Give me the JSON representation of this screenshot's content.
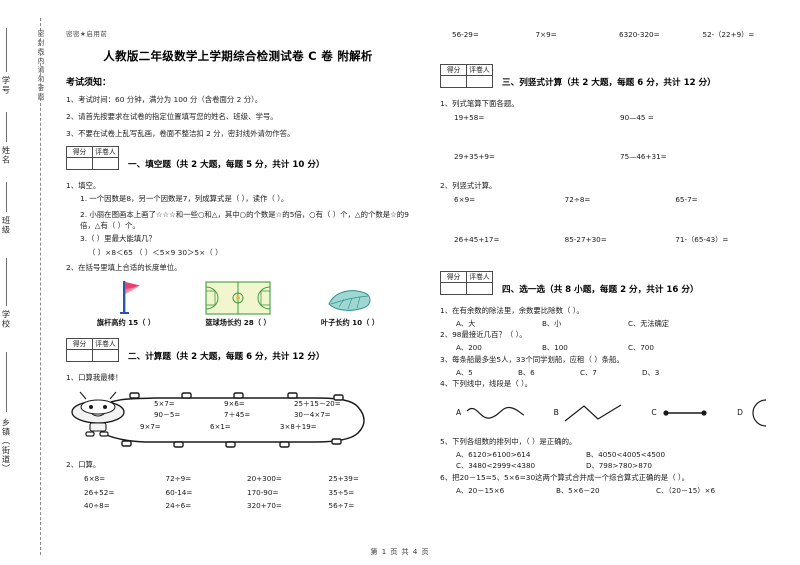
{
  "sidebar": {
    "fields": [
      "学号",
      "姓名",
      "班级",
      "学校",
      "乡镇（街道）"
    ],
    "seal_note": "密封线内请勿答题"
  },
  "header": {
    "secret_mark": "密密★启用前",
    "title": "人教版二年级数学上学期综合检测试卷 C 卷  附解析",
    "notice_title": "考试须知：",
    "notices": [
      "1、考试时间：60 分钟，满分为 100 分（含卷面分 2 分）。",
      "2、请首先按要求在试卷的指定位置填写您的姓名、班级、学号。",
      "3、不要在试卷上乱写乱画，卷面不整洁扣 2 分，密封线外请勿作答。"
    ]
  },
  "score_box": {
    "score_label": "得分",
    "grader_label": "评卷人"
  },
  "sections": {
    "one": {
      "title": "一、填空题（共 2 大题，每题 5 分，共计 10 分）",
      "q1_title": "1、填空。",
      "q1_items": [
        "1. 一个因数是8，另一个因数是7，列成算式是（                ），读作（                ）。",
        "2. 小丽在图画本上画了☆☆☆和一些○和△，其中○的个数是☆的5倍，○有（        ）个，△的个数是☆的9倍，△有（        ）个。",
        "3.（        ）里最大能填几？"
      ],
      "q1_fill": "（        ）×8＜65          （        ）＜5×9     30＞5×（        ）",
      "q2_title": "2、在括号里填上合适的长度单位。",
      "pictures": [
        {
          "icon": "flag-icon",
          "caption": "旗杆高约 15（        ）"
        },
        {
          "icon": "basketball-court-icon",
          "caption": "篮球场长约 28（        ）"
        },
        {
          "icon": "leaf-icon",
          "caption": "叶子长约 10（        ）"
        }
      ]
    },
    "two": {
      "title": "二、计算题（共 2 大题，每题 6 分，共计 12 分）",
      "q1_title": "1、口算我最棒！",
      "worm_items": [
        "5×7=",
        "9×6=",
        "25＋15－20=",
        "90－5=",
        "7＋45=",
        "30－4×7=",
        "9×7=",
        "6×1=",
        "3×8＋19="
      ],
      "q2_title": "2、口算。",
      "oral_items": [
        "6×8=",
        "72÷9=",
        "20+300=",
        "25+39=",
        "26+52=",
        "60-14=",
        "170-90=",
        "35÷5=",
        "40÷8=",
        "24÷6=",
        "320+70=",
        "56÷7=",
        "56-29=",
        "7×9=",
        "6320-320=",
        "52-（22+9）="
      ]
    },
    "three": {
      "title": "三、列竖式计算（共 2 大题，每题 6 分，共计 12 分）",
      "q1_title": "1、列式笔算下面各题。",
      "q1_items": [
        "19+58=",
        "90—45 =",
        "29+35+9=",
        "75—46+31="
      ],
      "q2_title": "2、列竖式计算。",
      "q2_items": [
        "6×9=",
        "72÷8=",
        "65-7=",
        "26+45+17=",
        "85-27+30=",
        "71-（65-43）="
      ]
    },
    "four": {
      "title": "四、选一选（共 8 小题，每题 2 分，共计 16 分）",
      "questions": [
        {
          "stem": "1、在有余数的除法里，余数要比除数（        ）。",
          "options": [
            "A、大",
            "B、小",
            "C、无法确定"
          ],
          "layout": "three"
        },
        {
          "stem": "2、98最接近几百？（        ）。",
          "options": [
            "A、200",
            "B、100",
            "C、700"
          ],
          "layout": "three"
        },
        {
          "stem": "3、每条船最多坐5人，33个同学划船，应租（        ）条船。",
          "options": [
            "A、5",
            "B、6",
            "C、7",
            "D、3"
          ],
          "layout": "four"
        },
        {
          "stem": "4、下列线中，线段是（        ）。",
          "options": [],
          "layout": "lines",
          "line_labels": [
            "A",
            "B",
            "C",
            "D"
          ]
        },
        {
          "stem": "5、下列各组数的排列中，（        ）是正确的。",
          "options": [
            "A、6120>6100>614",
            "B、4050<4005<4500",
            "C、3480<2999<4380",
            "D、798>780>870"
          ],
          "layout": "two"
        },
        {
          "stem": "6、把20－15=5、5×6=30这两个算式合并成一个综合算式正确的是（        ）。",
          "options": [
            "A、20－15×6",
            "B、5×6－20",
            "C、（20－15）×6"
          ],
          "layout": "three"
        }
      ]
    }
  },
  "footer": {
    "text": "第 1 页 共 4 页"
  },
  "colors": {
    "flag_cloth": "#e8416f",
    "flag_pole": "#2b55a8",
    "court_fill": "#f2f6cf",
    "court_stroke": "#3f9e3f",
    "leaf_fill": "#9fd8d2",
    "leaf_stroke": "#2f8f8a",
    "ink": "#1a1a1a"
  }
}
